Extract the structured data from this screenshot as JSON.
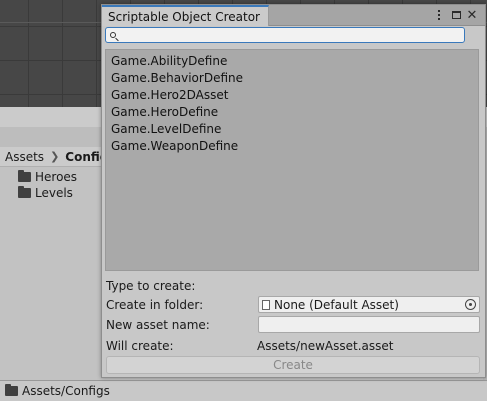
{
  "project": {
    "breadcrumb": [
      "Assets",
      "Configs"
    ],
    "folders": [
      "Heroes",
      "Levels"
    ],
    "status_path": "Assets/Configs"
  },
  "window": {
    "title": "Scriptable Object Creator",
    "search": {
      "value": "",
      "placeholder": ""
    },
    "types": [
      "Game.AbilityDefine",
      "Game.BehaviorDefine",
      "Game.Hero2DAsset",
      "Game.HeroDefine",
      "Game.LevelDefine",
      "Game.WeaponDefine"
    ],
    "form": {
      "type_label": "Type to create:",
      "type_value": "",
      "folder_label": "Create in folder:",
      "folder_value": "None (Default Asset)",
      "name_label": "New asset name:",
      "name_value": "",
      "will_create_label": "Will create:",
      "will_create_value": "Assets/newAsset.asset"
    },
    "create_button": "Create"
  },
  "icons": {
    "search": "search-icon",
    "folder": "folder-icon",
    "kebab": "kebab-menu-icon",
    "maximize": "maximize-icon",
    "close": "close-icon",
    "document": "document-icon",
    "object_picker": "object-picker-icon"
  },
  "colors": {
    "accent": "#3a79bb",
    "list_background": "#a9a9a9",
    "window_background": "#c8c8c8",
    "scene_background": "#474747"
  }
}
